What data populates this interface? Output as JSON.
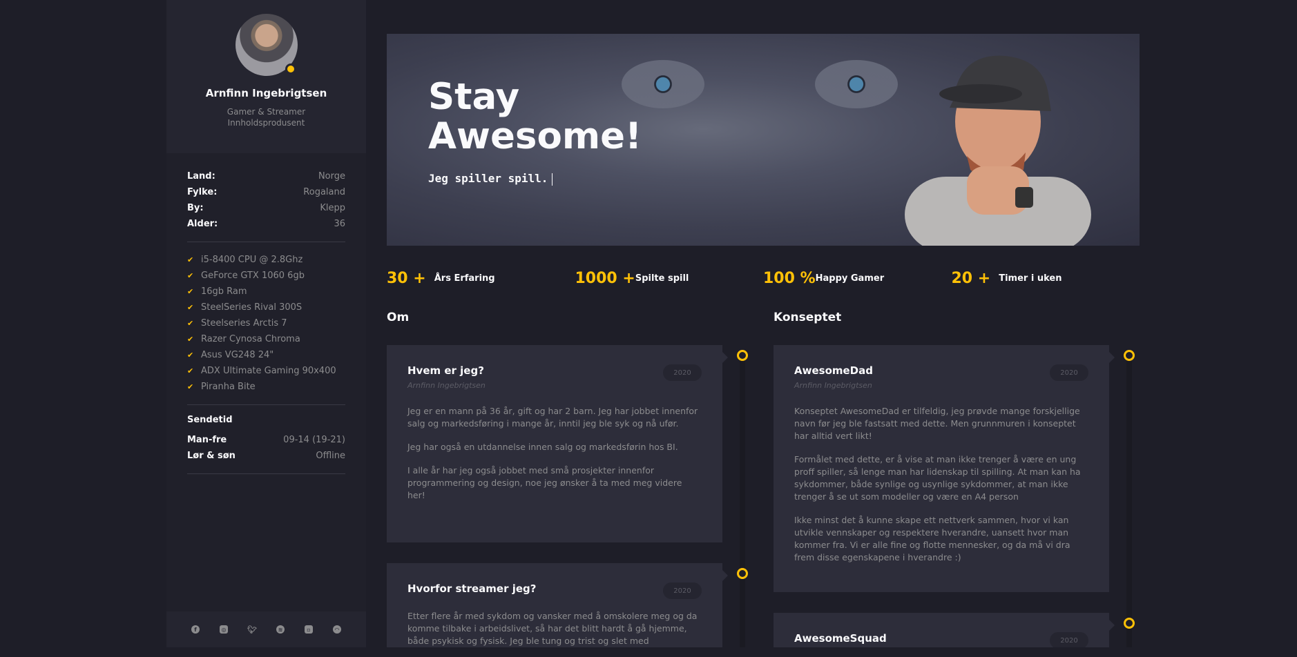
{
  "profile": {
    "name": "Arnfinn Ingebrigtsen",
    "role_line1": "Gamer & Streamer",
    "role_line2": "Innholdsprodusent"
  },
  "info": [
    {
      "key": "Land:",
      "value": "Norge"
    },
    {
      "key": "Fylke:",
      "value": "Rogaland"
    },
    {
      "key": "By:",
      "value": "Klepp"
    },
    {
      "key": "Alder:",
      "value": "36"
    }
  ],
  "gear": [
    "i5-8400 CPU @ 2.8Ghz",
    "GeForce GTX 1060 6gb",
    "16gb Ram",
    "SteelSeries Rival 300S",
    "Steelseries Arctis 7",
    "Razer Cynosa Chroma",
    "Asus VG248 24\"",
    "ADX Ultimate Gaming 90x400",
    "Piranha Bite"
  ],
  "schedule": {
    "title": "Sendetid",
    "rows": [
      {
        "key": "Man-fre",
        "value": "09-14 (19-21)"
      },
      {
        "key": "Lør & søn",
        "value": "Offline"
      }
    ]
  },
  "socials": [
    "facebook-icon",
    "instagram-icon",
    "twitter-icon",
    "spotify-icon",
    "discord-icon",
    "snapchat-icon"
  ],
  "hero": {
    "title_line1": "Stay",
    "title_line2": "Awesome!",
    "typed": "Jeg spiller spill."
  },
  "stats": [
    {
      "num": "30 +",
      "label": "Års Erfaring"
    },
    {
      "num": "1000 +",
      "label": "Spilte spill"
    },
    {
      "num": "100 %",
      "label": "Happy Gamer"
    },
    {
      "num": "20 +",
      "label": "Timer i uken"
    }
  ],
  "columns": {
    "left_title": "Om",
    "right_title": "Konseptet"
  },
  "cards": {
    "left": [
      {
        "title": "Hvem er jeg?",
        "author": "Arnfinn Ingebrigtsen",
        "year": "2020",
        "paragraphs": [
          "Jeg er en mann på 36 år, gift og har 2 barn. Jeg har jobbet innenfor salg og markedsføring i mange år, inntil jeg ble syk og nå ufør.",
          "Jeg har også en utdannelse innen salg og markedsførin hos BI.",
          "I alle år har jeg også jobbet med små prosjekter innenfor programmering og design, noe jeg ønsker å ta med meg videre her!"
        ]
      },
      {
        "title": "Hvorfor streamer jeg?",
        "year": "2020",
        "paragraphs": [
          "Etter flere år med sykdom og vansker med å omskolere meg og da komme tilbake i arbeidslivet, så har det blitt hardt å gå hjemme, både psykisk og fysisk. Jeg ble tung og trist og slet med"
        ]
      }
    ],
    "right": [
      {
        "title": "AwesomeDad",
        "author": "Arnfinn Ingebrigtsen",
        "year": "2020",
        "paragraphs": [
          "Konseptet AwesomeDad er tilfeldig, jeg prøvde mange forskjellige navn før jeg ble fastsatt med dette. Men grunnmuren i konseptet har alltid vert likt!",
          "Formålet med dette, er å vise at man ikke trenger å være en ung proff spiller, så lenge man har lidenskap til spilling. At man kan ha sykdommer, både synlige og usynlige sykdommer, at man ikke trenger å se ut som modeller og være en A4 person",
          "Ikke minst det å kunne skape ett nettverk sammen, hvor vi kan utvikle vennskaper og respektere hverandre, uansett hvor man kommer fra. Vi er alle fine og flotte mennesker, og da må vi dra frem disse egenskapene i hverandre :)"
        ]
      },
      {
        "title": "AwesomeSquad",
        "year": "2020",
        "paragraphs": []
      }
    ]
  }
}
